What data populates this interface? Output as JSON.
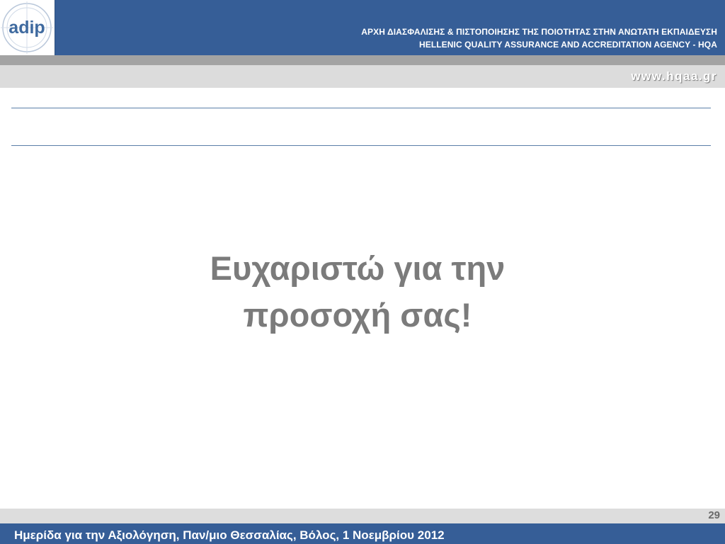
{
  "header": {
    "title_greek": "ΑΡΧΗ ΔΙΑΣΦΑΛΙΣΗΣ & ΠΙΣΤΟΠΟΙΗΣΗΣ ΤΗΣ ΠΟΙΟΤΗΤΑΣ ΣΤΗΝ ΑΝΩΤΑΤΗ ΕΚΠΑΙΔΕΥΣΗ",
    "title_english": "HELLENIC QUALITY ASSURANCE AND ACCREDITATION AGENCY - HQA",
    "logo_text": "adip",
    "website": "www.hqaa.gr"
  },
  "main": {
    "line1": "Ευχαριστώ για την",
    "line2": "προσοχή σας!"
  },
  "footer": {
    "page_number": "29",
    "event_text": "Ημερίδα για την Αξιολόγηση, Παν/μιο Θεσσαλίας, Βόλος, 1 Νοεμβρίου 2012"
  },
  "colors": {
    "brand_blue": "#365e97",
    "text_gray": "#7b7b7b",
    "stripe_gray": "#a3a3a3",
    "light_gray": "#dcdcdc"
  }
}
